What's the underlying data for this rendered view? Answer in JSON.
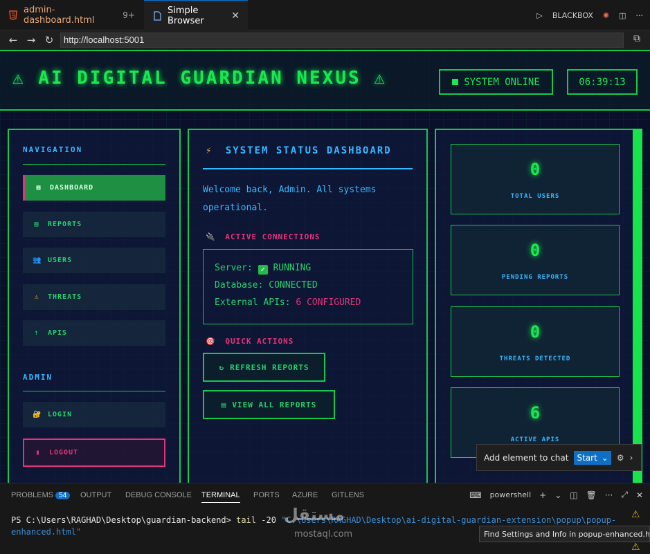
{
  "editor": {
    "tabs": [
      {
        "label": "admin-dashboard.html",
        "modified": "9+"
      },
      {
        "label": "Simple Browser"
      }
    ],
    "actions": {
      "run_label": "BLACKBOX"
    }
  },
  "browser": {
    "url": "http://localhost:5001"
  },
  "site": {
    "title": "⚠ AI DIGITAL GUARDIAN NEXUS ⚠",
    "status": "SYSTEM ONLINE",
    "clock": "06:39:13"
  },
  "sidebar": {
    "nav_heading": "NAVIGATION",
    "items": [
      {
        "icon": "▦",
        "label": "DASHBOARD"
      },
      {
        "icon": "▤",
        "label": "REPORTS"
      },
      {
        "icon": "👥",
        "label": "USERS"
      },
      {
        "icon": "⚠",
        "label": "THREATS"
      },
      {
        "icon": "⇡",
        "label": "APIS"
      }
    ],
    "admin_heading": "ADMIN",
    "admin_items": [
      {
        "icon": "🔐",
        "label": "LOGIN"
      },
      {
        "icon": "▮",
        "label": "LOGOUT"
      }
    ]
  },
  "main": {
    "title_icon": "⚡",
    "title": "SYSTEM STATUS DASHBOARD",
    "welcome": "Welcome back, Admin. All systems operational.",
    "connections_icon": "🔌",
    "connections_heading": "ACTIVE CONNECTIONS",
    "connections": {
      "server_label": "Server:",
      "server_value": "RUNNING",
      "database_label": "Database:",
      "database_value": "CONNECTED",
      "apis_label": "External APIs:",
      "apis_count": "6",
      "apis_suffix": "CONFIGURED"
    },
    "quick_actions_icon": "🎯",
    "quick_actions_heading": "QUICK ACTIONS",
    "buttons": [
      {
        "icon": "↻",
        "label": "REFRESH REPORTS"
      },
      {
        "icon": "▤",
        "label": "VIEW ALL REPORTS"
      }
    ]
  },
  "stats": [
    {
      "value": "0",
      "label": "TOTAL USERS"
    },
    {
      "value": "0",
      "label": "PENDING REPORTS"
    },
    {
      "value": "0",
      "label": "THREATS DETECTED"
    },
    {
      "value": "6",
      "label": "ACTIVE APIS"
    }
  ],
  "chat_popup": {
    "label": "Add element to chat",
    "start": "Start"
  },
  "panel": {
    "tabs": [
      {
        "label": "PROBLEMS",
        "badge": "54"
      },
      {
        "label": "OUTPUT"
      },
      {
        "label": "DEBUG CONSOLE"
      },
      {
        "label": "TERMINAL"
      },
      {
        "label": "PORTS"
      },
      {
        "label": "AZURE"
      },
      {
        "label": "GITLENS"
      }
    ],
    "shell": "powershell"
  },
  "terminal": {
    "prompt": "PS C:\\Users\\RAGHAD\\Desktop\\guardian-backend>",
    "command": "tail",
    "args": "-20",
    "path": "\"C:\\Users\\RAGHAD\\Desktop\\ai-digital-guardian-extension\\popup\\popup-enhanced.html\""
  },
  "tooltip": "Find Settings and Info in popup-enhanced.html",
  "watermark": {
    "arabic": "مستقل",
    "latin": "mostaql.com"
  },
  "colors": {
    "neon_green": "#19e94f",
    "cyan": "#3ab8ff",
    "pink": "#e5337a",
    "page_bg": "#0a0f2a"
  }
}
